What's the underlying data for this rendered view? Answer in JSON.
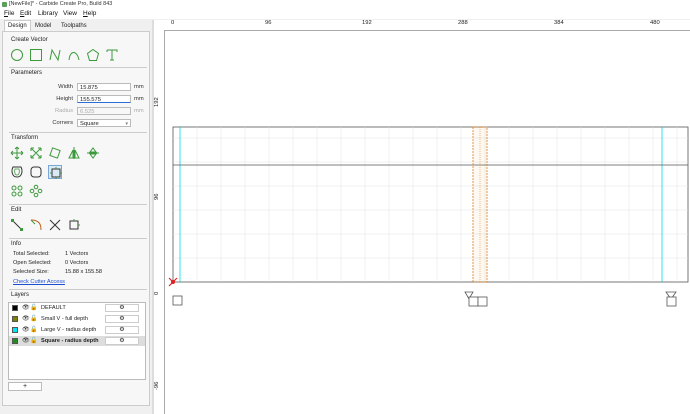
{
  "window": {
    "title": "[NewFile]* - Carbide Create Pro, Build 843"
  },
  "menu": [
    {
      "first": "F",
      "rest": "ile"
    },
    {
      "first": "E",
      "rest": "dit"
    },
    {
      "first": "",
      "rest": "Library"
    },
    {
      "first": "",
      "rest": "View"
    },
    {
      "first": "H",
      "rest": "elp"
    }
  ],
  "tabs": [
    "Design",
    "Model",
    "Toolpaths"
  ],
  "sections": {
    "create_vector": "Create Vector",
    "parameters": "Parameters",
    "transform": "Transform",
    "edit": "Edit",
    "info": "Info",
    "layers": "Layers"
  },
  "parameters": {
    "width_label": "Width",
    "width_value": "15.875",
    "width_unit": "mm",
    "height_label": "Height",
    "height_value": "155.575",
    "height_unit": "mm",
    "radius_label": "Radius",
    "radius_value": "6.525",
    "radius_unit": "mm",
    "corners_label": "Corners",
    "corners_value": "Square"
  },
  "info": {
    "total_selected_label": "Total Selected:",
    "total_selected_value": "1 Vectors",
    "open_selected_label": "Open Selected:",
    "open_selected_value": "0 Vectors",
    "selected_size_label": "Selected Size:",
    "selected_size_value": "15.88 x 155.58",
    "check_cutter_link": "Check Cutter Access"
  },
  "layers": [
    {
      "name": "DEFAULT",
      "color": "#000000"
    },
    {
      "name": "Small V - full depth",
      "color": "#808000"
    },
    {
      "name": "Large V - radius depth",
      "color": "#00e5ee"
    },
    {
      "name": "Square - radius depth",
      "color": "#1e8c1e"
    }
  ],
  "layers_add_label": "+",
  "ruler": {
    "top": [
      "0",
      "96",
      "192",
      "288",
      "384",
      "480"
    ],
    "left": [
      "192",
      "96",
      "0",
      "-96"
    ]
  },
  "colors": {
    "accent": "#3c9a3c",
    "selection": "#e08020",
    "link": "#1d4fd1"
  }
}
